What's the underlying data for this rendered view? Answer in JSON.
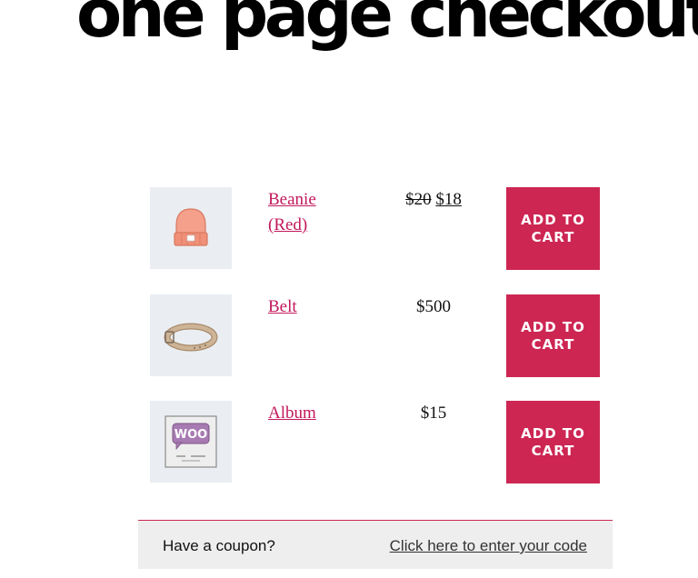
{
  "page": {
    "title": "one page checkout"
  },
  "products": [
    {
      "name": "Beanie (Red)",
      "price_regular": "$20",
      "price_sale": "$18",
      "price": "",
      "button_label": "Add to cart",
      "image_icon": "beanie-icon"
    },
    {
      "name": "Belt",
      "price_regular": "",
      "price_sale": "",
      "price": "$500",
      "button_label": "Add to cart",
      "image_icon": "belt-icon"
    },
    {
      "name": "Album",
      "price_regular": "",
      "price_sale": "",
      "price": "$15",
      "button_label": "Add to cart",
      "image_icon": "album-icon"
    }
  ],
  "coupon": {
    "prompt": "Have a coupon?",
    "link": "Click here to enter your code"
  },
  "colors": {
    "accent": "#cd2653",
    "link": "#c2185b",
    "thumb_background": "#eaeef2",
    "coupon_background": "#eeeeee"
  }
}
